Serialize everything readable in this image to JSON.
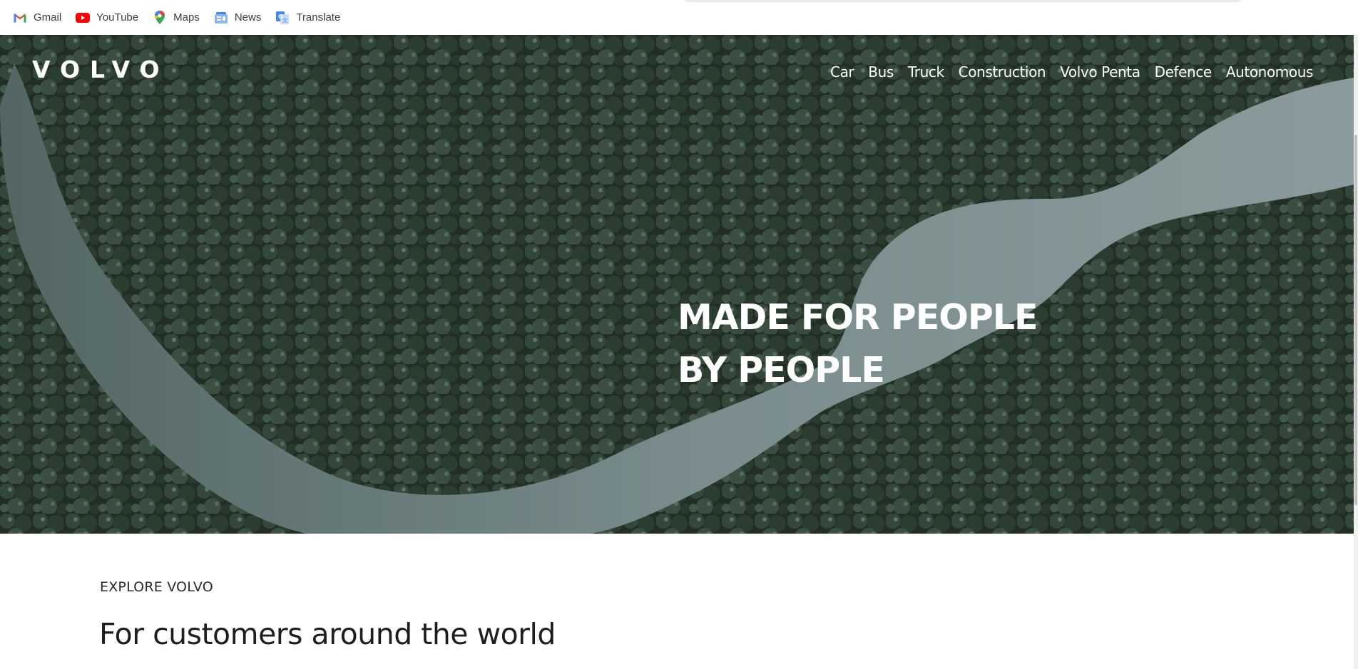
{
  "bookmarks": [
    {
      "label": "Gmail",
      "icon": "gmail-icon"
    },
    {
      "label": "YouTube",
      "icon": "youtube-icon"
    },
    {
      "label": "Maps",
      "icon": "maps-icon"
    },
    {
      "label": "News",
      "icon": "news-icon"
    },
    {
      "label": "Translate",
      "icon": "translate-icon"
    }
  ],
  "header": {
    "logo": "VOLVO",
    "nav": [
      "Car",
      "Bus",
      "Truck",
      "Construction",
      "Volvo Penta",
      "Defence",
      "Autonomous"
    ]
  },
  "hero": {
    "headline_line1": "MADE FOR PEOPLE",
    "headline_line2": "BY PEOPLE"
  },
  "section": {
    "eyebrow": "EXPLORE VOLVO",
    "title": "For customers around the world"
  },
  "colors": {
    "forest": "#2c3a30",
    "river": "#7f9593",
    "text_white": "#ffffff"
  }
}
